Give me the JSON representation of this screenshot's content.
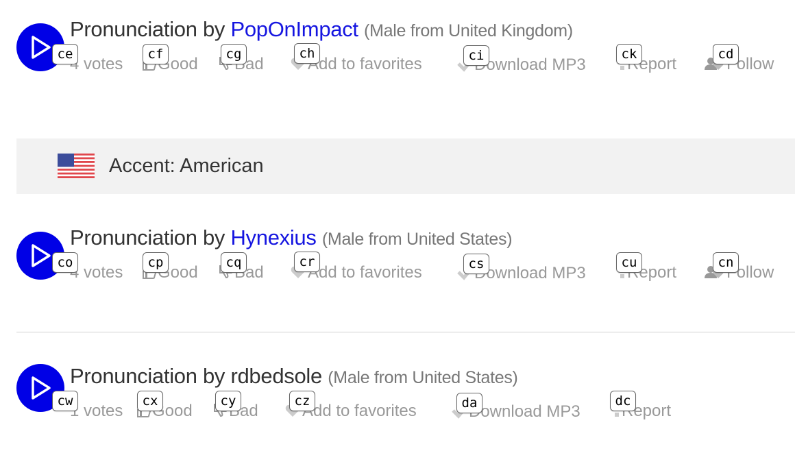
{
  "entries": [
    {
      "prefix": "Pronunciation by",
      "user": "PopOnImpact",
      "meta": "(Male from United Kingdom)",
      "votes": "4 votes",
      "good": "Good",
      "bad": "Bad",
      "favorites": "Add to favorites",
      "download": "Download MP3",
      "report": "Report",
      "follow": "Follow",
      "tags": {
        "play": "ce",
        "good": "cf",
        "bad": "cg",
        "favorites": "ch",
        "download": "ci",
        "report": "ck",
        "follow": "cd"
      }
    },
    {
      "prefix": "Pronunciation by",
      "user": "Hynexius",
      "meta": "(Male from United States)",
      "votes": "4 votes",
      "good": "Good",
      "bad": "Bad",
      "favorites": "Add to favorites",
      "download": "Download MP3",
      "report": "Report",
      "follow": "Follow",
      "tags": {
        "play": "co",
        "good": "cp",
        "bad": "cq",
        "favorites": "cr",
        "download": "cs",
        "report": "cu",
        "follow": "cn"
      }
    },
    {
      "prefix": "Pronunciation by",
      "user": "rdbedsole",
      "meta": "(Male from United States)",
      "votes": "1 votes",
      "good": "Good",
      "bad": "Bad",
      "favorites": "Add to favorites",
      "download": "Download MP3",
      "report": "Report",
      "tags": {
        "play": "cw",
        "good": "cx",
        "bad": "cy",
        "favorites": "cz",
        "download": "da",
        "report": "dc"
      }
    }
  ],
  "accent": {
    "label": "Accent: American",
    "flag_icon": "us-flag-icon"
  },
  "colors": {
    "play": "#0000e6",
    "link": "#1515e0",
    "muted": "#999999",
    "accent_bg": "#f2f2f2"
  }
}
